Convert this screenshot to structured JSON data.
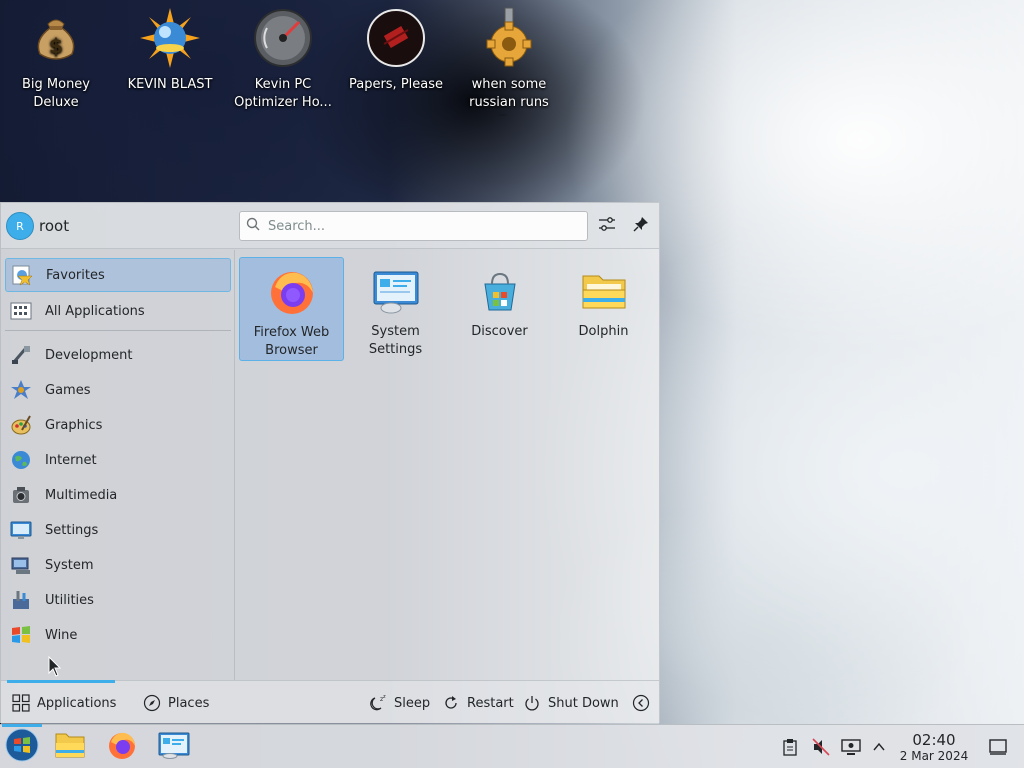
{
  "desktop": {
    "icons": [
      {
        "label": "Big Money Deluxe",
        "icon": "money-bag-icon"
      },
      {
        "label": "KEVIN BLAST",
        "icon": "sun-globe-icon"
      },
      {
        "label": "Kevin PC Optimizer Ho...",
        "icon": "speedometer-icon"
      },
      {
        "label": "Papers, Please",
        "icon": "papers-please-icon"
      },
      {
        "label": "when some russian runs a...",
        "icon": "gear-icon"
      }
    ]
  },
  "launcher": {
    "user": {
      "initial": "R",
      "name": "root"
    },
    "search": {
      "placeholder": "Search..."
    },
    "sidebar": {
      "items": [
        {
          "label": "Favorites",
          "icon": "favorites-icon",
          "active": true
        },
        {
          "label": "All Applications",
          "icon": "all-applications-icon"
        },
        {
          "label": "Development",
          "icon": "development-icon"
        },
        {
          "label": "Games",
          "icon": "games-icon"
        },
        {
          "label": "Graphics",
          "icon": "graphics-icon"
        },
        {
          "label": "Internet",
          "icon": "internet-icon"
        },
        {
          "label": "Multimedia",
          "icon": "multimedia-icon"
        },
        {
          "label": "Settings",
          "icon": "settings-icon"
        },
        {
          "label": "System",
          "icon": "system-icon"
        },
        {
          "label": "Utilities",
          "icon": "utilities-icon"
        },
        {
          "label": "Wine",
          "icon": "wine-icon"
        }
      ]
    },
    "favorites": [
      {
        "label": "Firefox Web Browser",
        "icon": "firefox-icon",
        "active": true
      },
      {
        "label": "System Settings",
        "icon": "system-settings-icon"
      },
      {
        "label": "Discover",
        "icon": "discover-icon"
      },
      {
        "label": "Dolphin",
        "icon": "dolphin-folder-icon"
      }
    ],
    "footer": {
      "applications": "Applications",
      "places": "Places",
      "sleep": "Sleep",
      "restart": "Restart",
      "shutdown": "Shut Down"
    }
  },
  "taskbar": {
    "clock": {
      "time": "02:40",
      "date": "2 Mar 2024"
    }
  },
  "colors": {
    "accent": "#3daee9",
    "selection": "#93b5e0",
    "panel": "#eff0f1"
  }
}
